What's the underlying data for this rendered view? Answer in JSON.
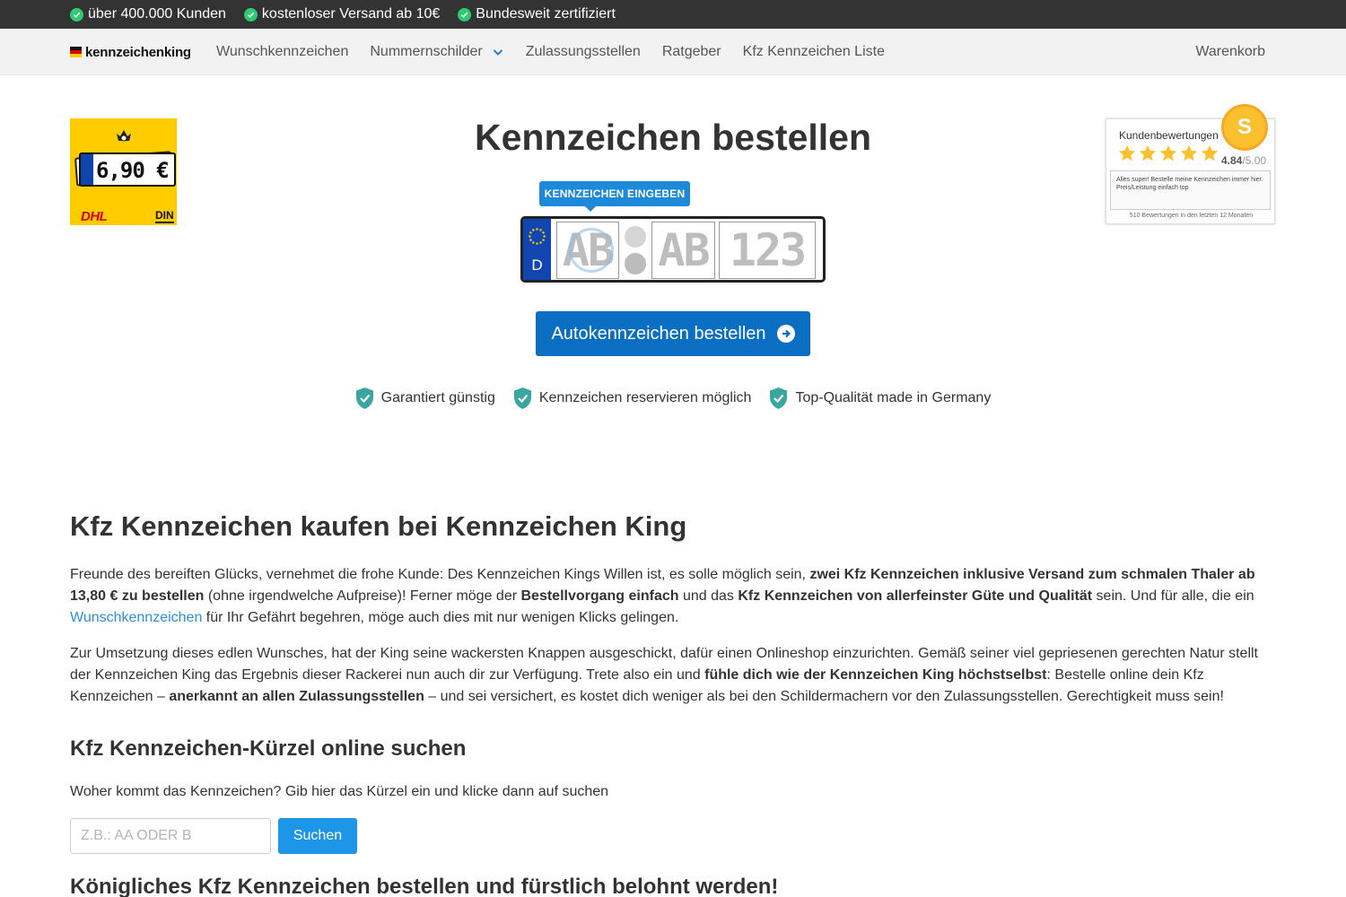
{
  "topbar": {
    "usps": [
      "über 400.000 Kunden",
      "kostenloser Versand ab 10€",
      "Bundesweit zertifiziert"
    ]
  },
  "nav": {
    "logo": "kennzeichenking",
    "links": [
      "Wunschkennzeichen",
      "Nummernschilder",
      "Zulassungsstellen",
      "Ratgeber",
      "Kfz Kennzeichen Liste"
    ],
    "cart": "Warenkorb"
  },
  "promo": {
    "country": "D",
    "price": "6,90 €",
    "carrier": "DHL",
    "norm": "DIN"
  },
  "hero": {
    "title": "Kennzeichen bestellen",
    "tooltip": "KENNZEICHEN EINGEBEN",
    "plate_country": "D",
    "plate_area": "AB",
    "plate_letters": "AB",
    "plate_numbers": "123",
    "cta": "Autokennzeichen bestellen",
    "features": [
      "Garantiert günstig",
      "Kennzeichen reservieren möglich",
      "Top-Qualität made in Germany"
    ]
  },
  "review": {
    "title": "Kundenbewertungen",
    "score": "4.84",
    "max": "/5.00",
    "quote": "Alles super! Bestelle meine Kennzeichen immer hier. Preis/Leistung einfach top",
    "count": "510 Bewertungen in den letzten 12 Monaten",
    "seal_letter": "S"
  },
  "content": {
    "h1": "Kfz Kennzeichen kaufen bei Kennzeichen King",
    "p1": [
      "Freunde des bereiften Glücks, vernehmet die frohe Kunde: Des Kennzeichen Kings Willen ist, es solle möglich sein, ",
      "zwei Kfz Kennzeichen inklusive Versand zum schmalen Thaler ab 13,80 € zu bestellen",
      " (ohne irgendwelche Aufpreise)! Ferner möge der ",
      "Bestellvorgang einfach",
      " und das ",
      "Kfz Kennzeichen von allerfeinster Güte und Qualität",
      " sein. Und für alle, die ein ",
      "Wunschkennzeichen",
      " für Ihr Gefährt begehren, möge auch dies mit nur wenigen Klicks gelingen."
    ],
    "p2": [
      "Zur Umsetzung dieses edlen Wunsches, hat der King seine wackersten Knappen ausgeschickt, dafür einen Onlineshop einzurichten. Gemäß seiner viel gepriesenen gerechten Natur stellt der Kennzeichen King das Ergebnis dieser Rackerei nun auch dir zur Verfügung. Trete also ein und ",
      "fühle dich wie der Kennzeichen King höchstselbst",
      ": Bestelle online dein Kfz Kennzeichen – ",
      "anerkannt an allen Zulassungsstellen",
      " – und sei versichert, es kostet dich weniger als bei den Schildermachern vor den Zulassungsstellen. Gerechtigkeit muss sein!"
    ],
    "h2": "Kfz Kennzeichen-Kürzel online suchen",
    "search_label": "Woher kommt das Kennzeichen? Gib hier das Kürzel ein und klicke dann auf suchen",
    "search_placeholder": "Z.B.: AA ODER B",
    "search_value": "",
    "search_button": "Suchen",
    "h3": "Königliches Kfz Kennzeichen bestellen und fürstlich belohnt werden!"
  },
  "colors": {
    "topbar": "#333333",
    "accent_blue": "#0a6ec2",
    "link_blue": "#2a8fdc",
    "check_green": "#2ecc71",
    "shield_green": "#3aa6a0",
    "promo_yellow": "#ffcc00",
    "star_yellow": "#fbc02d"
  },
  "icons": [
    "check-circle-icon",
    "chevron-down-icon",
    "crown-icon",
    "eu-stars-icon",
    "arrow-right-circle-icon",
    "shield-check-icon",
    "star-icon"
  ]
}
